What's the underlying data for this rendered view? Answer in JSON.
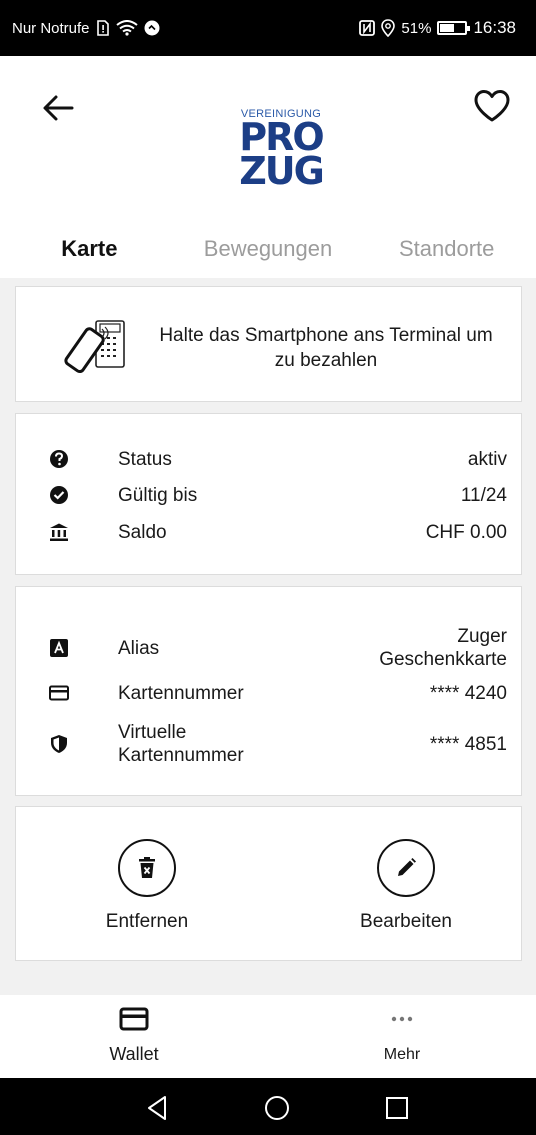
{
  "statusbar": {
    "carrier": "Nur Notrufe",
    "battery": "51%",
    "battery_level": 0.51,
    "time": "16:38"
  },
  "header": {
    "logo_top": "VEREINIGUNG",
    "logo_line1": "PRO",
    "logo_line2": "ZUG",
    "back_icon": "arrow-left-icon",
    "favorite_icon": "heart-outline-icon"
  },
  "tabs": [
    {
      "label": "Karte",
      "active": true
    },
    {
      "label": "Bewegungen",
      "active": false
    },
    {
      "label": "Standorte",
      "active": false
    }
  ],
  "pay": {
    "text": "Halte das Smartphone ans Terminal um zu bezahlen"
  },
  "details": [
    {
      "icon": "question-circle-icon",
      "label": "Status",
      "value": "aktiv"
    },
    {
      "icon": "check-circle-icon",
      "label": "Gültig bis",
      "value": "11/24"
    },
    {
      "icon": "bank-icon",
      "label": "Saldo",
      "value": "CHF 0.00"
    }
  ],
  "card_info": [
    {
      "icon": "alias-a-icon",
      "label": "Alias",
      "value": "Zuger Geschenkkarte"
    },
    {
      "icon": "credit-card-icon",
      "label": "Kartennummer",
      "value": "**** 4240"
    },
    {
      "icon": "shield-icon",
      "label": "Virtuelle Kartennummer",
      "value": "**** 4851"
    }
  ],
  "actions": {
    "remove": "Entfernen",
    "edit": "Bearbeiten"
  },
  "bottomnav": {
    "wallet": "Wallet",
    "more": "Mehr"
  },
  "colors": {
    "logo_blue": "#1c3e86",
    "inactive_tab": "#9c9c9c"
  }
}
